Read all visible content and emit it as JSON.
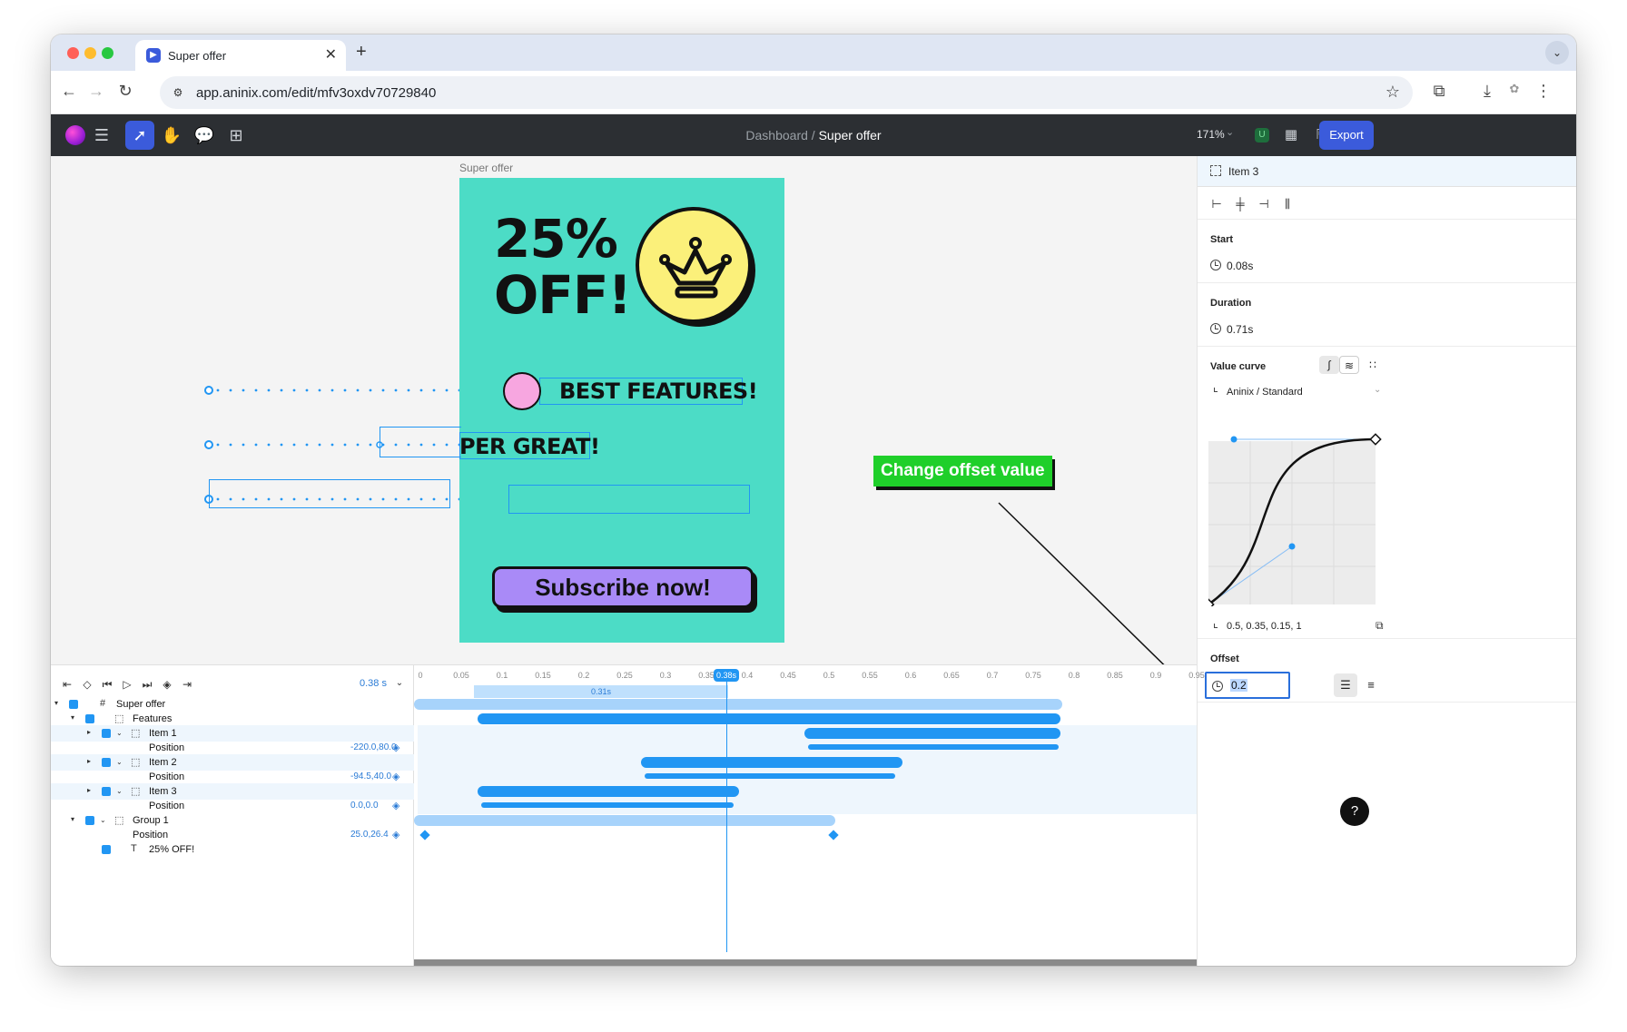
{
  "browser": {
    "tab_title": "Super offer",
    "tab_close": "✕",
    "new_tab": "+",
    "url": "app.aninix.com/edit/mfv3oxdv70729840"
  },
  "toolbar": {
    "breadcrumb_parent": "Dashboard",
    "breadcrumb_sep": " / ",
    "breadcrumb_current": "Super offer",
    "zoom": "171%",
    "presence_initial": "U",
    "export_label": "Export"
  },
  "canvas": {
    "frame_label": "Super offer",
    "headline_line1": "25%",
    "headline_line2": "OFF!",
    "feature_text": "BEST FEATURES!",
    "item2_text": "PER GREAT!",
    "cta_label": "Subscribe now!",
    "callout": "Change offset value",
    "help": "?"
  },
  "inspector": {
    "selection_name": "Item 3",
    "start_label": "Start",
    "start_value": "0.08s",
    "duration_label": "Duration",
    "duration_value": "0.71s",
    "value_curve_label": "Value curve",
    "curve_preset": "Aninix / Standard",
    "curve_values": "0.5, 0.35, 0.15, 1",
    "offset_label": "Offset",
    "offset_value": "0.2"
  },
  "timeline": {
    "current_time": "0.38 s",
    "playhead_label": "0.38s",
    "range_label": "0.31s",
    "ticks": [
      "0",
      "0.05",
      "0.1",
      "0.15",
      "0.2",
      "0.25",
      "0.3",
      "0.35",
      "0.4",
      "0.45",
      "0.5",
      "0.55",
      "0.6",
      "0.65",
      "0.7",
      "0.75",
      "0.8",
      "0.85",
      "0.9",
      "0.95"
    ],
    "layers": [
      {
        "name": "Super offer",
        "value": ""
      },
      {
        "name": "Features",
        "value": ""
      },
      {
        "name": "Item 1",
        "value": ""
      },
      {
        "name": "Position",
        "value": "-220.0,80.0"
      },
      {
        "name": "Item 2",
        "value": ""
      },
      {
        "name": "Position",
        "value": "-94.5,40.0"
      },
      {
        "name": "Item 3",
        "value": ""
      },
      {
        "name": "Position",
        "value": "0.0,0.0"
      },
      {
        "name": "Group 1",
        "value": ""
      },
      {
        "name": "Position",
        "value": "25.0,26.4"
      },
      {
        "name": "25% OFF!",
        "value": ""
      }
    ]
  },
  "colors": {
    "accent": "#3b5bdb",
    "timeline_blue": "#2196f3",
    "artboard_bg": "#4cdcc6",
    "cta_bg": "#a98af7",
    "callout_bg": "#1fcf2a",
    "crown_bg": "#fbf07a"
  }
}
